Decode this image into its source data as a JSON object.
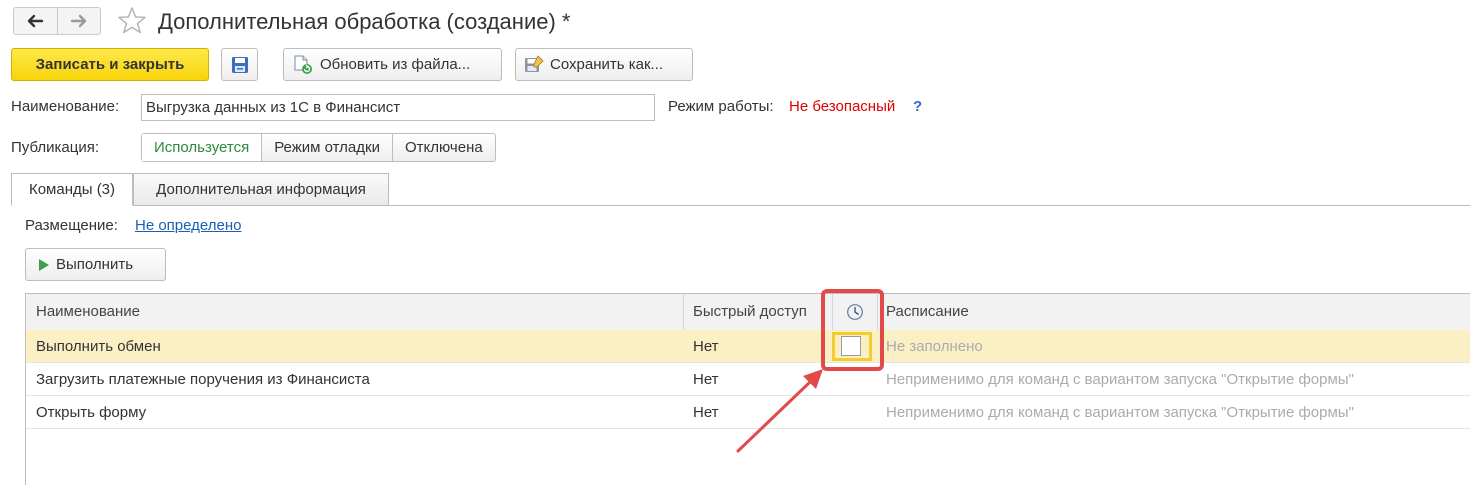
{
  "window": {
    "title": "Дополнительная обработка (создание) *",
    "back_icon": "arrow-left-icon",
    "forward_icon": "arrow-right-icon",
    "favorite_icon": "star-icon"
  },
  "toolbar": {
    "save_close_label": "Записать и закрыть",
    "save_icon": "floppy-disk-icon",
    "refresh_label": "Обновить из файла...",
    "saveas_label": "Сохранить как..."
  },
  "form": {
    "name_label": "Наименование:",
    "name_value": "Выгрузка данных из 1С в Финансист",
    "mode_label": "Режим работы:",
    "mode_value": "Не безопасный",
    "mode_help": "?",
    "publication_label": "Публикация:",
    "publication_options": [
      "Используется",
      "Режим отладки",
      "Отключена"
    ],
    "publication_selected": "Используется"
  },
  "tabs": [
    {
      "label": "Команды (3)",
      "active": true
    },
    {
      "label": "Дополнительная информация",
      "active": false
    }
  ],
  "commands": {
    "placement_label": "Размещение:",
    "placement_value": "Не определено",
    "run_label": "Выполнить",
    "table": {
      "columns": [
        "Наименование",
        "Быстрый доступ",
        "",
        "Расписание"
      ],
      "schedule_column_icon": "clock-icon",
      "rows": [
        {
          "name": "Выполнить обмен",
          "quick": "Нет",
          "scheduled": false,
          "schedule": "Не заполнено",
          "selected": true
        },
        {
          "name": "Загрузить платежные поручения из Финансиста",
          "quick": "Нет",
          "schedule": "Неприменимо для команд с вариантом запуска \"Открытие формы\"",
          "selected": false
        },
        {
          "name": "Открыть форму",
          "quick": "Нет",
          "schedule": "Неприменимо для команд с вариантом запуска \"Открытие формы\"",
          "selected": false
        }
      ]
    }
  },
  "colors": {
    "primary_button": "#f7d40a",
    "danger_text": "#e00000",
    "active_option": "#2e8b3e",
    "link": "#1a5fb4",
    "annotation": "#e24a4a",
    "selected_row": "#fbf0c4"
  }
}
